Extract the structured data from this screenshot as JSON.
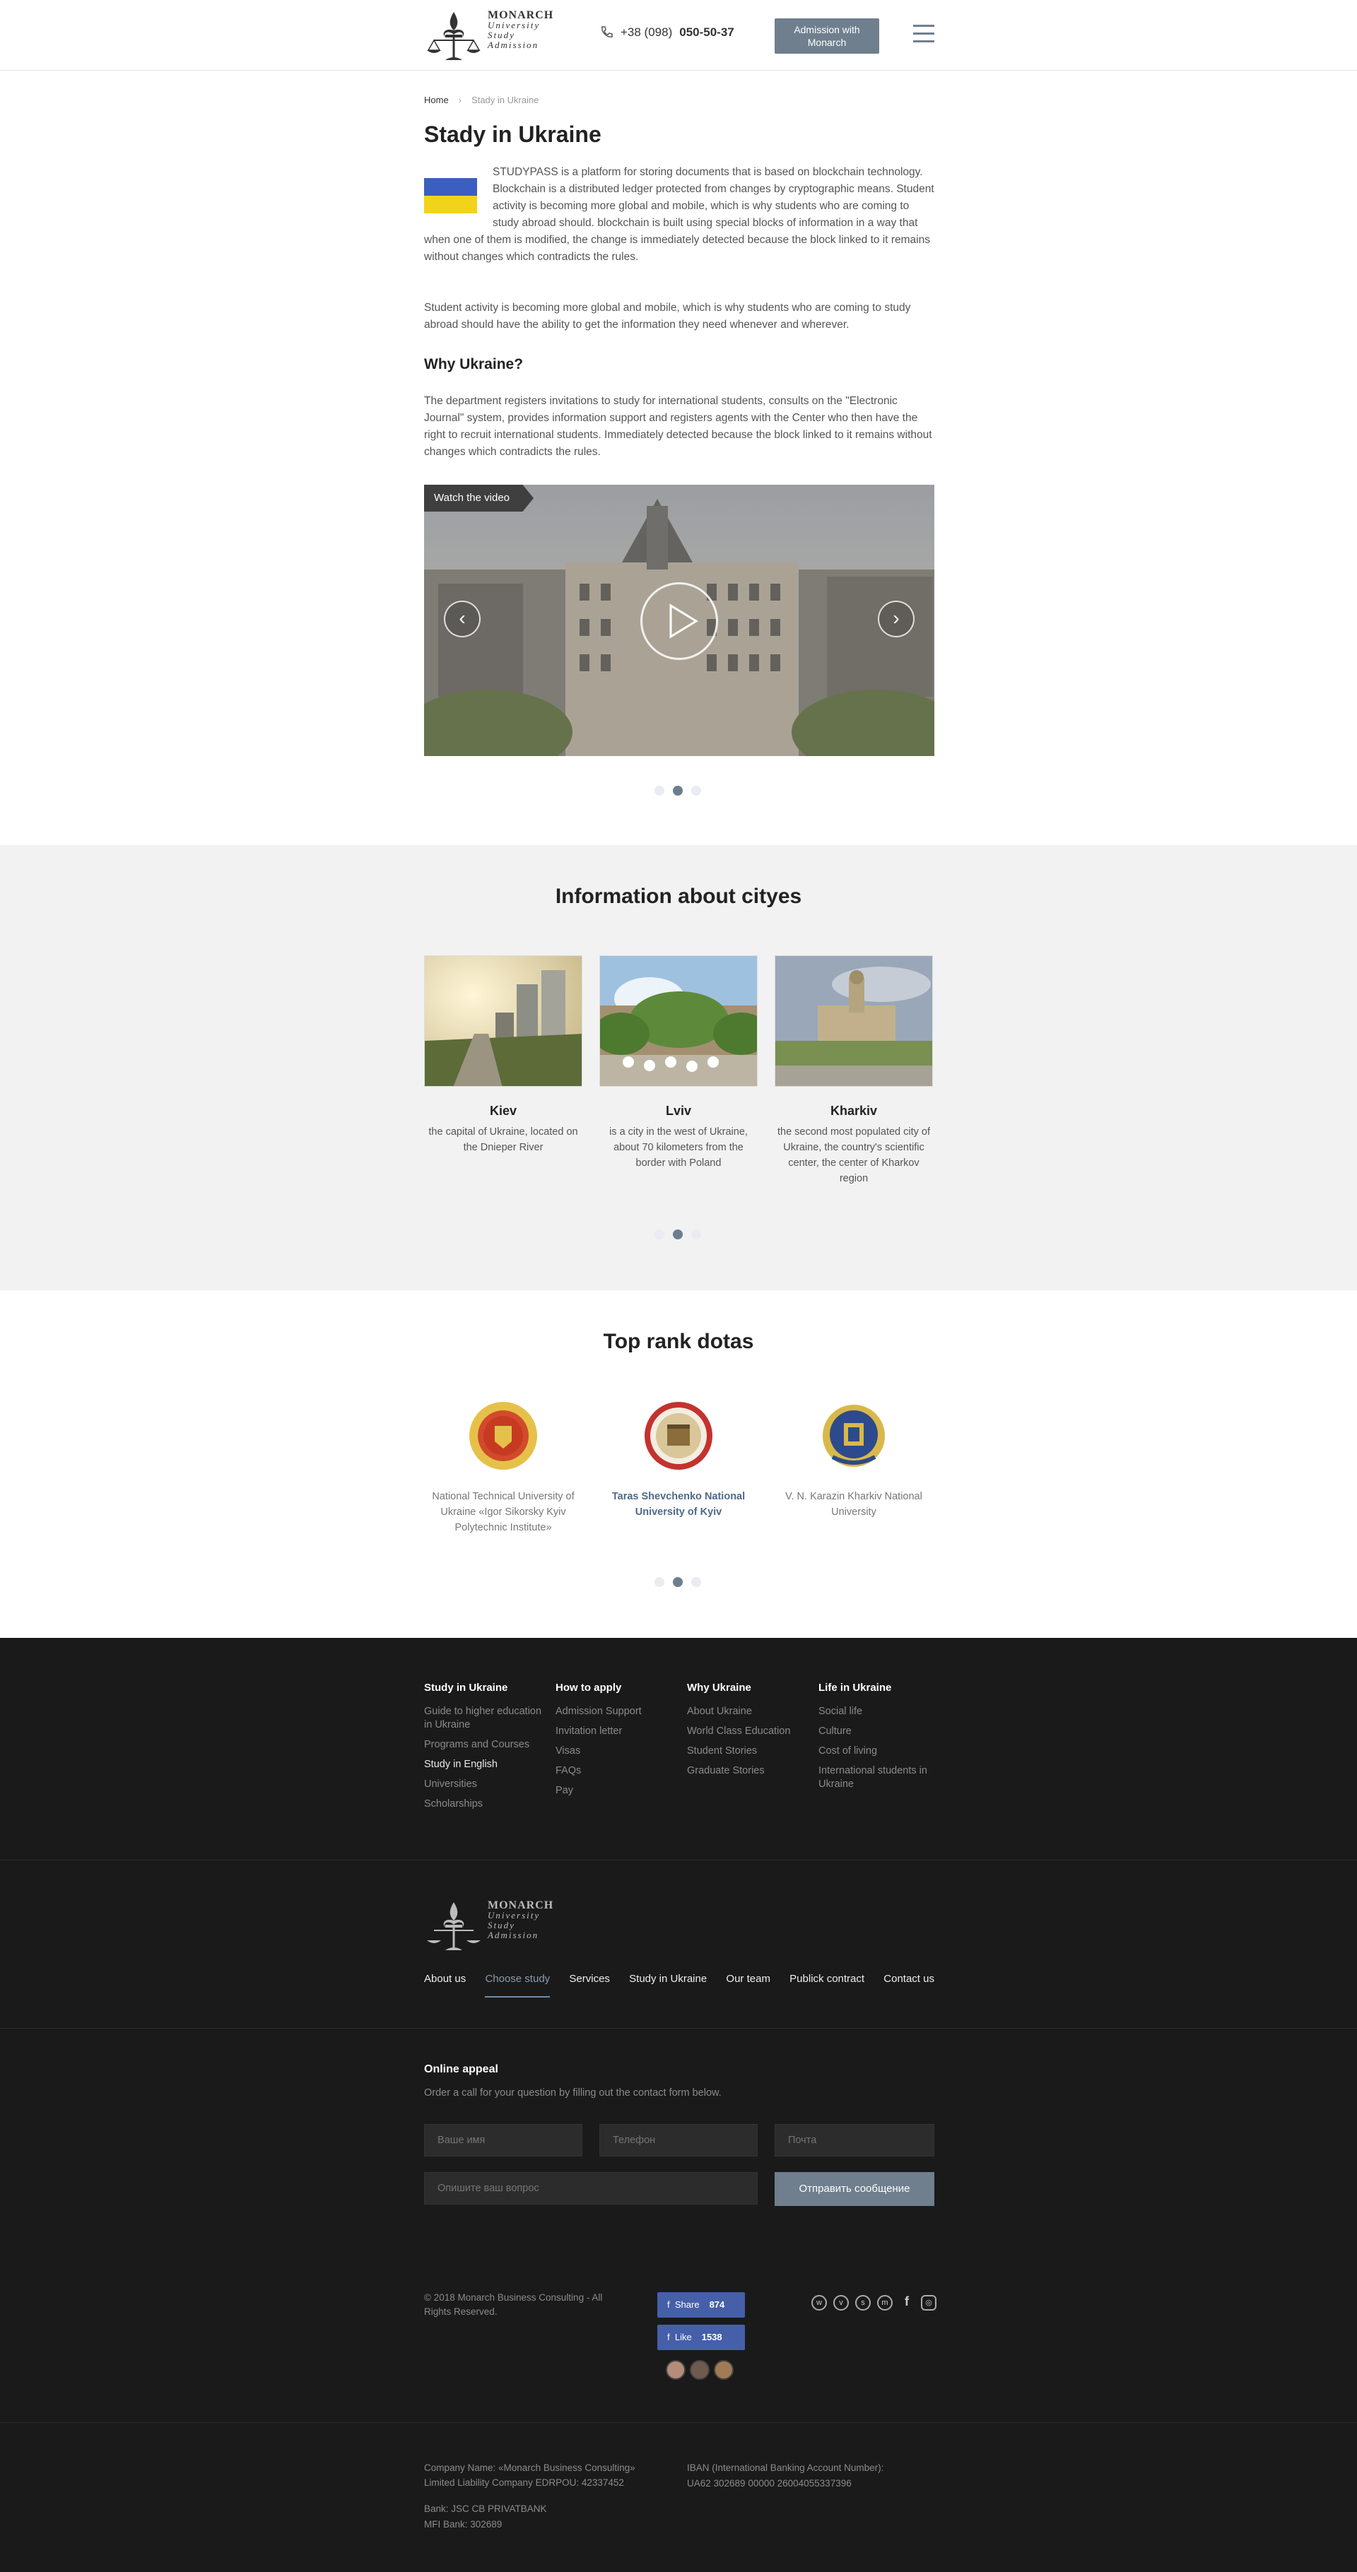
{
  "header": {
    "logo": {
      "line1": "MONARCH",
      "line2": "University",
      "line3": "Study",
      "line4": "Admission"
    },
    "phone_prefix": "+38 (098)",
    "phone_number": "050-50-37",
    "admission_button": "Admission with Monarch"
  },
  "breadcrumbs": {
    "home": "Home",
    "current": "Stady in Ukraine"
  },
  "page_title": "Stady in Ukraine",
  "intro_text": "STUDYPASS is a platform for storing documents that is based on blockchain technology. Blockchain is a distributed ledger protected from changes by cryptographic means. Student activity is becoming more global and mobile, which is why students who are coming to study abroad should. blockchain is built using special blocks of information in a way that when one of them is modified, the change is immediately detected because the block linked to it remains without changes which contradicts the rules.",
  "para2": "Student activity is becoming more global and mobile, which is why students who are coming to study abroad should have the ability to get the information they need whenever and wherever.",
  "why_title": "Why Ukraine?",
  "para3": "The department registers invitations to study for international students, consults on the \"Electronic Journal\" system, provides information support and registers agents with the Center who then have the right to recruit international students. Immediately detected because the block linked to it remains without changes which contradicts the rules.",
  "video": {
    "label": "Watch the video",
    "prev": "‹",
    "next": "›",
    "active_slide": 2,
    "total_slides": 3
  },
  "cities": {
    "title": "Information about cityes",
    "items": [
      {
        "name": "Kiev",
        "desc": "the capital of Ukraine, located on the Dnieper River"
      },
      {
        "name": "Lviv",
        "desc": "is a city in the west of Ukraine, about 70 kilometers from the border with Poland"
      },
      {
        "name": "Kharkiv",
        "desc": "the second most populated city of Ukraine, the country's scientific center, the center of Kharkov region"
      }
    ]
  },
  "universities": {
    "title": "Top rank dotas",
    "items": [
      {
        "name": "National Technical University of Ukraine «Igor Sikorsky Kyiv Polytechnic Institute»",
        "active": false
      },
      {
        "name": "Taras Shevchenko National University of Kyiv",
        "active": true
      },
      {
        "name": "V. N. Karazin Kharkiv National University",
        "active": false
      }
    ]
  },
  "footer": {
    "columns": [
      {
        "title": "Study in Ukraine",
        "items": [
          "Guide to higher education in Ukraine",
          "Programs and Courses",
          "Study in English",
          "Universities",
          "Scholarships"
        ]
      },
      {
        "title": "How to apply",
        "items": [
          "Admission Support",
          "Invitation letter",
          "Visas",
          "FAQs",
          "Pay"
        ]
      },
      {
        "title": "Why Ukraine",
        "items": [
          "About Ukraine",
          "World Class Education",
          "Student Stories",
          "Graduate Stories"
        ]
      },
      {
        "title": "Life in Ukraine",
        "items": [
          "Social life",
          "Culture",
          "Cost of living",
          "International students in Ukraine"
        ]
      }
    ],
    "nav": [
      "About us",
      "Choose study",
      "Services",
      "Study in Ukraine",
      "Our team",
      "Publick contract",
      "Contact us"
    ],
    "nav_active": "Choose study",
    "appeal_title": "Online appeal",
    "appeal_text": "Order a call for your question by filling out the contact form below.",
    "form": {
      "name_placeholder": "Ваше имя",
      "phone_placeholder": "Телефон",
      "email_placeholder": "Почта",
      "question_placeholder": "Опишите ваш вопрос",
      "submit": "Отправить сообщение"
    },
    "copyright": "© 2018 Monarch Business Consulting - All Rights Reserved.",
    "share": {
      "label": "Share",
      "count": "874"
    },
    "like": {
      "label": "Like",
      "count": "1538"
    },
    "socials": [
      "whatsapp-icon",
      "viber-icon",
      "skype-icon",
      "messenger-icon",
      "facebook-icon",
      "instagram-icon"
    ],
    "company": {
      "name": "Company Name: «Monarch Business Consulting» Limited Liability Company EDRPOU: 42337452",
      "bank": "Bank: JSC CB PRIVATBANK",
      "mfi": "MFI Bank: 302689",
      "iban_label": "IBAN (International Banking Account Number):",
      "iban": "UA62 302689 00000 26004055337396"
    }
  }
}
